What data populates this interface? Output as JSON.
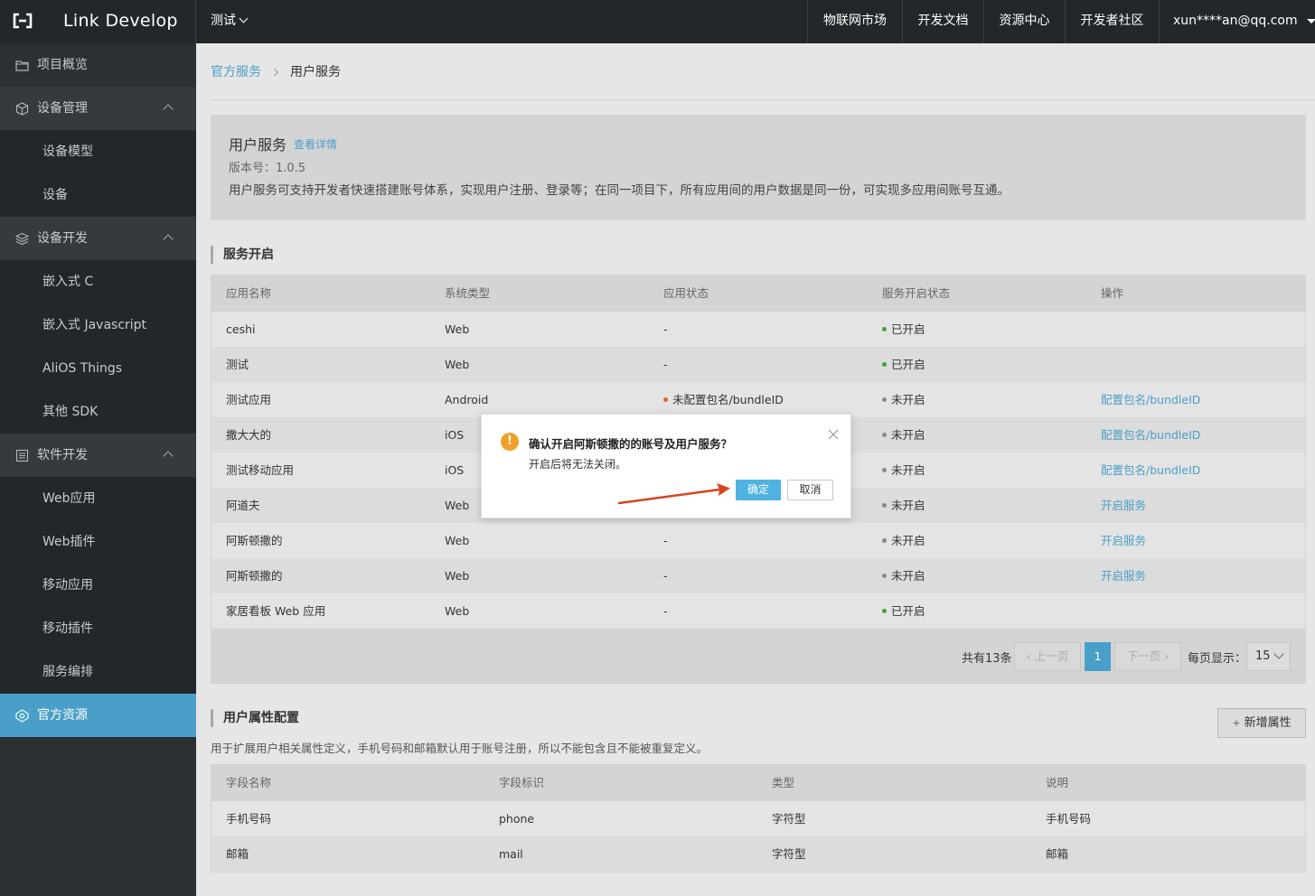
{
  "topbar": {
    "brand": "Link Develop",
    "project": "测试",
    "nav": [
      "物联网市场",
      "开发文档",
      "资源中心",
      "开发者社区"
    ],
    "user": "xun****an@qq.com"
  },
  "sidebar": {
    "items": [
      {
        "label": "项目概览",
        "icon": "folder-icon"
      },
      {
        "label": "设备管理",
        "icon": "cube-icon"
      },
      {
        "label": "设备模型"
      },
      {
        "label": "设备"
      },
      {
        "label": "设备开发",
        "icon": "layers-icon"
      },
      {
        "label": "嵌入式 C"
      },
      {
        "label": "嵌入式 Javascript"
      },
      {
        "label": "AliOS Things"
      },
      {
        "label": "其他 SDK"
      },
      {
        "label": "软件开发",
        "icon": "list-icon"
      },
      {
        "label": "Web应用"
      },
      {
        "label": "Web插件"
      },
      {
        "label": "移动应用"
      },
      {
        "label": "移动插件"
      },
      {
        "label": "服务编排"
      },
      {
        "label": "官方资源",
        "icon": "resource-icon"
      }
    ]
  },
  "breadcrumb": {
    "parent": "官方服务",
    "current": "用户服务"
  },
  "service_info": {
    "title": "用户服务",
    "detail_link": "查看详情",
    "version": "版本号：1.0.5",
    "description": "用户服务可支持开发者快速搭建账号体系，实现用户注册、登录等；在同一项目下，所有应用间的用户数据是同一份，可实现多应用间账号互通。"
  },
  "service_section": {
    "title": "服务开启",
    "columns": [
      "应用名称",
      "系统类型",
      "应用状态",
      "服务开启状态",
      "操作"
    ],
    "rows": [
      {
        "name": "ceshi",
        "type": "Web",
        "app_status": "-",
        "service_status": "已开启",
        "action": ""
      },
      {
        "name": "测试",
        "type": "Web",
        "app_status": "-",
        "service_status": "已开启",
        "action": ""
      },
      {
        "name": "测试应用",
        "type": "Android",
        "app_status": "未配置包名/bundleID",
        "service_status": "未开启",
        "action": "配置包名/bundleID"
      },
      {
        "name": "撒大大的",
        "type": "iOS",
        "app_status": "",
        "service_status": "未开启",
        "action": "配置包名/bundleID"
      },
      {
        "name": "测试移动应用",
        "type": "iOS",
        "app_status": "",
        "service_status": "未开启",
        "action": "配置包名/bundleID"
      },
      {
        "name": "阿道夫",
        "type": "Web",
        "app_status": "",
        "service_status": "未开启",
        "action": "开启服务"
      },
      {
        "name": "阿斯顿撒的",
        "type": "Web",
        "app_status": "-",
        "service_status": "未开启",
        "action": "开启服务"
      },
      {
        "name": "阿斯顿撒的",
        "type": "Web",
        "app_status": "-",
        "service_status": "未开启",
        "action": "开启服务"
      },
      {
        "name": "家居看板 Web 应用",
        "type": "Web",
        "app_status": "-",
        "service_status": "已开启",
        "action": ""
      }
    ],
    "pager": {
      "total": "共有13条",
      "prev": "上一页",
      "page": "1",
      "next": "下一页",
      "size_label": "每页显示：",
      "size": "15"
    }
  },
  "attr_section": {
    "title": "用户属性配置",
    "add_button": "新增属性",
    "add_icon": "+",
    "description": "用于扩展用户相关属性定义，手机号码和邮箱默认用于账号注册，所以不能包含且不能被重复定义。",
    "columns": [
      "字段名称",
      "字段标识",
      "类型",
      "说明"
    ],
    "rows": [
      {
        "name": "手机号码",
        "key": "phone",
        "type": "字符型",
        "desc": "手机号码"
      },
      {
        "name": "邮箱",
        "key": "mail",
        "type": "字符型",
        "desc": "邮箱"
      }
    ]
  },
  "modal": {
    "title": "确认开启阿斯顿撒的的账号及用户服务？",
    "message": "开启后将无法关闭。",
    "ok": "确定",
    "cancel": "取消",
    "warn_glyph": "!"
  },
  "colors": {
    "accent": "#4a9fc8",
    "active_dot": "#3aa63a",
    "inactive_dot": "#888888",
    "warning_dot": "#e0632a",
    "annotation_arrow": "#d9431e"
  }
}
